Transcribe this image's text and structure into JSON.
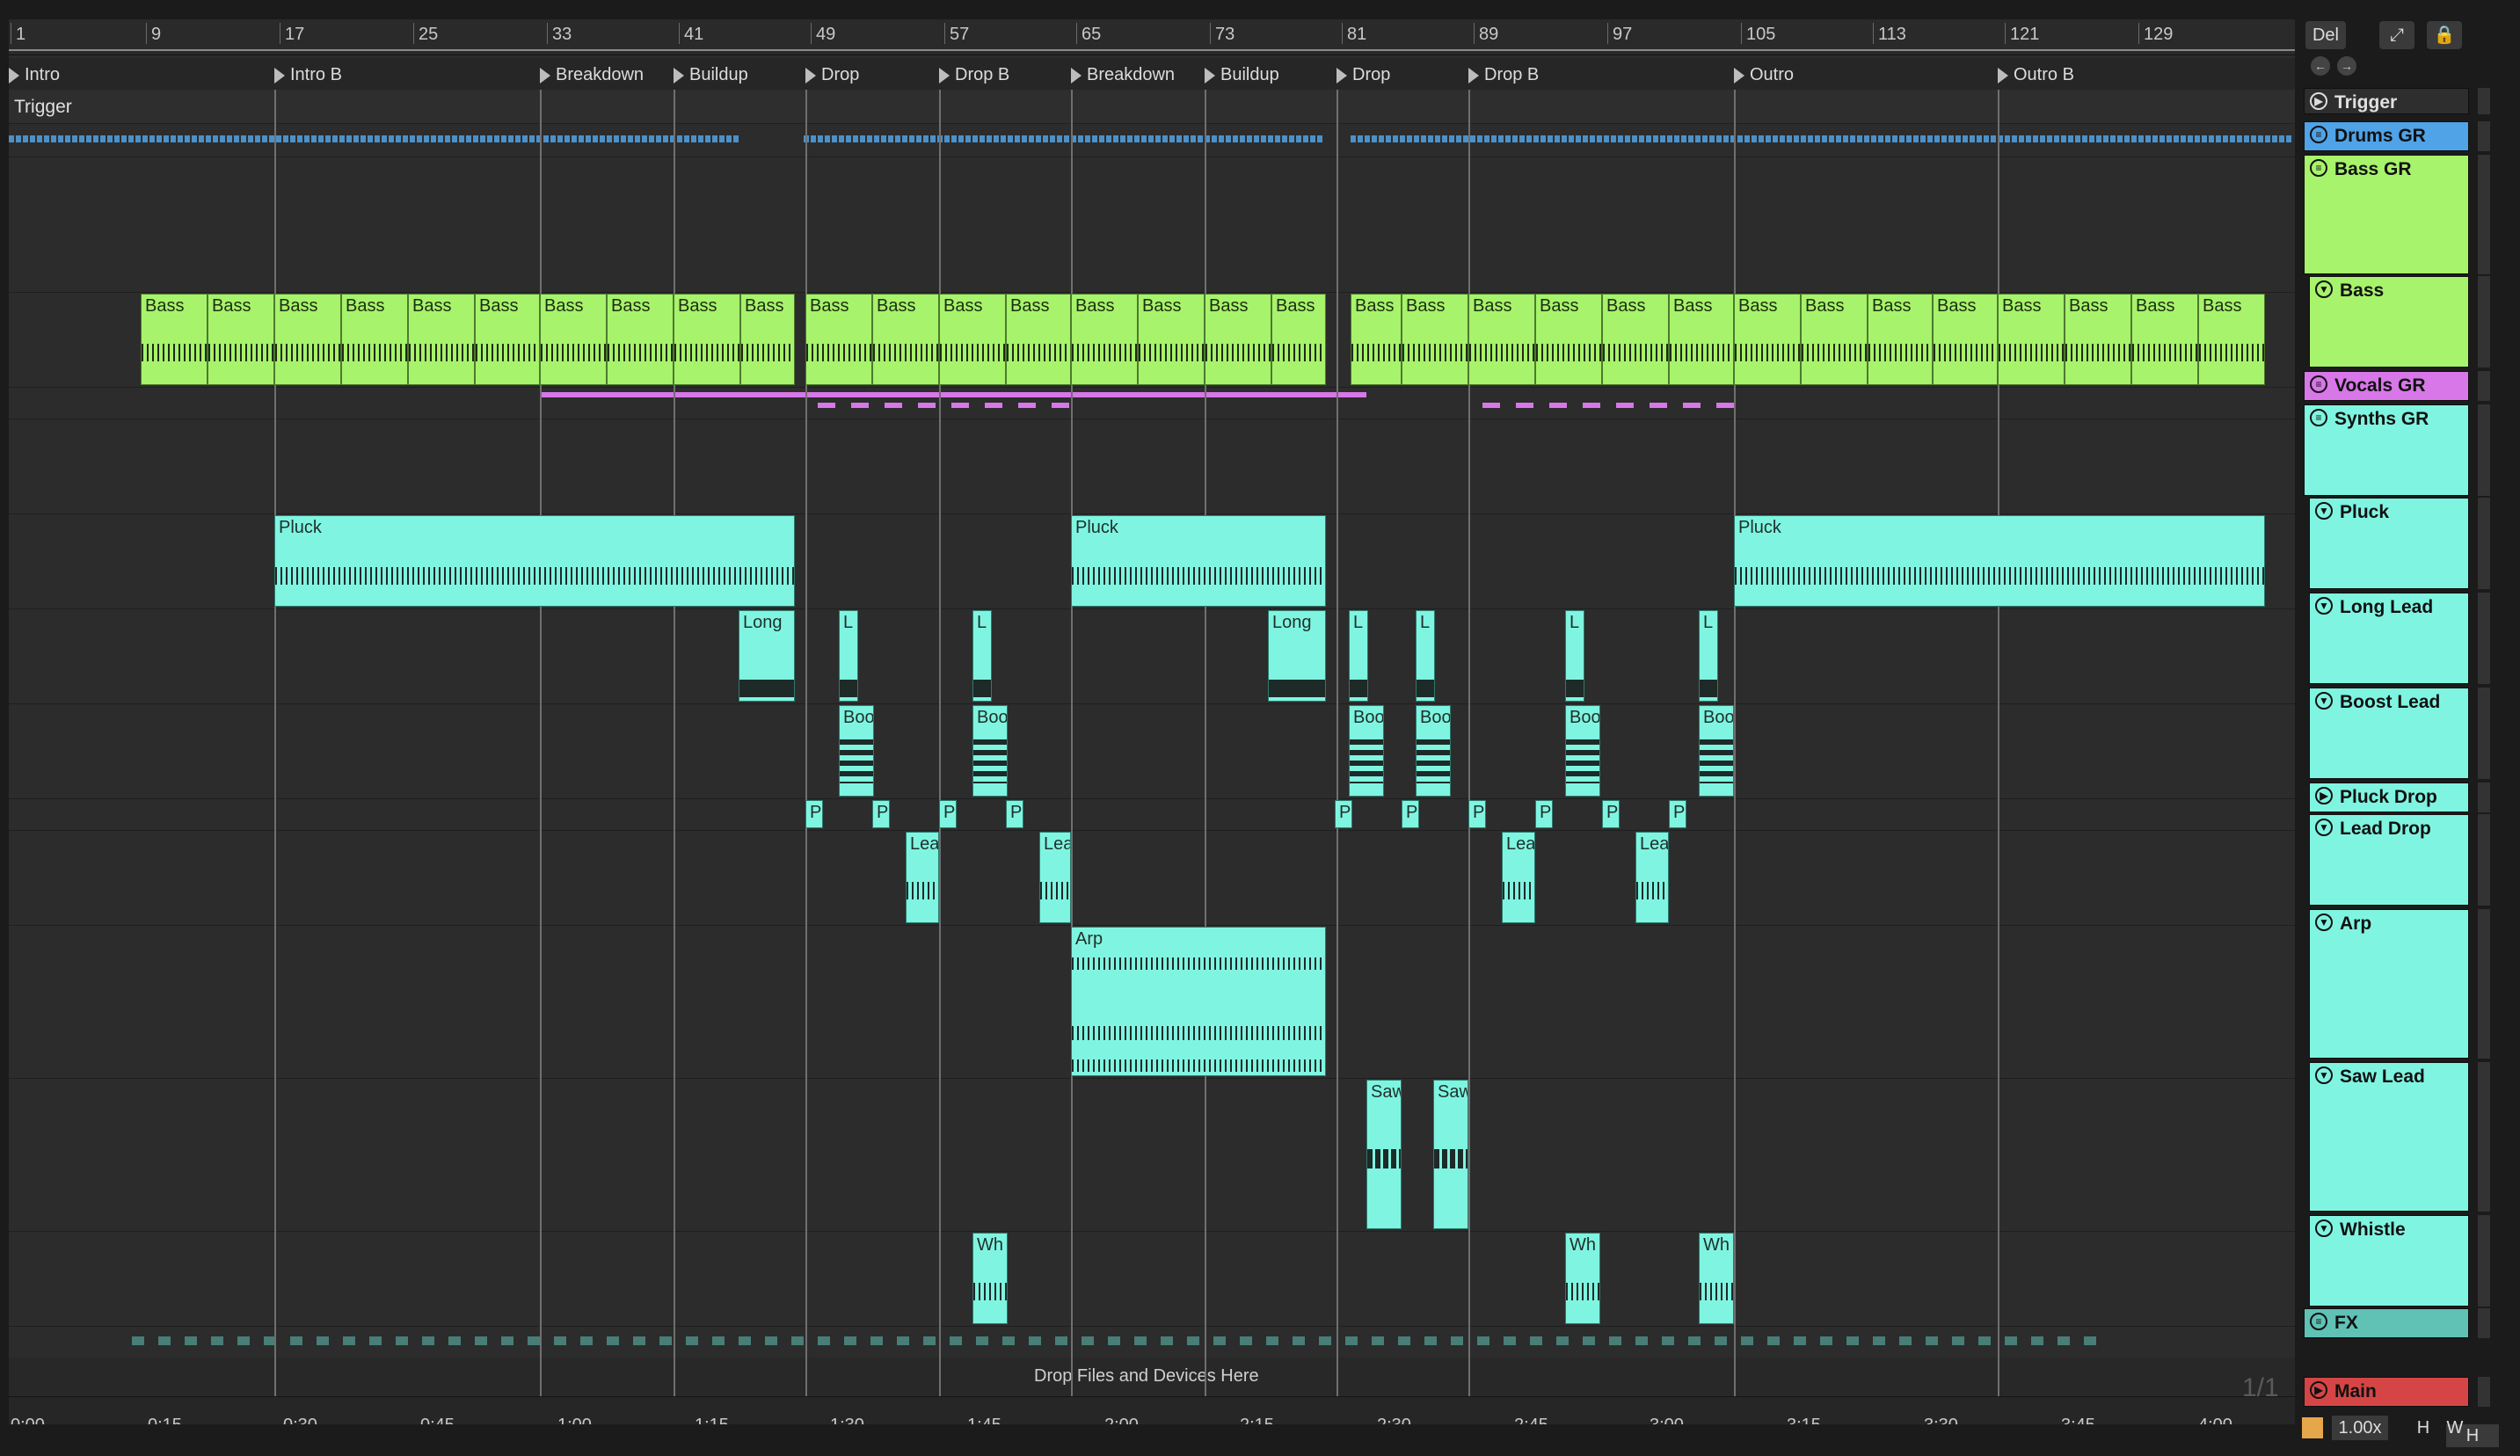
{
  "ruler": {
    "bars": [
      "1",
      "9",
      "17",
      "25",
      "33",
      "41",
      "49",
      "57",
      "65",
      "73",
      "81",
      "89",
      "97",
      "105",
      "113",
      "121",
      "129"
    ]
  },
  "locators": [
    "Intro",
    "Intro B",
    "Breakdown",
    "Buildup",
    "Drop",
    "Drop B",
    "Breakdown",
    "Buildup",
    "Drop",
    "Drop B",
    "Outro",
    "Outro B"
  ],
  "timeline": [
    "0:00",
    "0:15",
    "0:30",
    "0:45",
    "1:00",
    "1:15",
    "1:30",
    "1:45",
    "2:00",
    "2:15",
    "2:30",
    "2:45",
    "3:00",
    "3:15",
    "3:30",
    "3:45",
    "4:00"
  ],
  "trigger_label": "Trigger",
  "drop_files": "Drop Files and Devices Here",
  "page_indicator": "1/1",
  "controls": {
    "del": "Del",
    "zoom": "1.00x",
    "h": "H",
    "w": "W"
  },
  "clips": {
    "bass": "Bass",
    "pluck": "Pluck",
    "long": "Long",
    "long_short": "L",
    "boost_short": "Boo",
    "pluckdrop_short": "P",
    "lead_short": "Lea",
    "arp": "Arp",
    "saw_short": "Saw",
    "whistle_short": "Wh"
  },
  "tracks": [
    {
      "name": "Trigger",
      "color": "#2a2a2a"
    },
    {
      "name": "Drums GR",
      "color": "#4fa3e6"
    },
    {
      "name": "Bass GR",
      "color": "#a7f36b"
    },
    {
      "name": "Bass",
      "color": "#a7f36b"
    },
    {
      "name": "Vocals GR",
      "color": "#d777e8"
    },
    {
      "name": "Synths GR",
      "color": "#7ff5e1"
    },
    {
      "name": "Pluck",
      "color": "#7ff5e1"
    },
    {
      "name": "Long Lead",
      "color": "#7ff5e1"
    },
    {
      "name": "Boost Lead",
      "color": "#7ff5e1"
    },
    {
      "name": "Pluck Drop",
      "color": "#7ff5e1"
    },
    {
      "name": "Lead Drop",
      "color": "#7ff5e1"
    },
    {
      "name": "Arp",
      "color": "#7ff5e1"
    },
    {
      "name": "Saw Lead",
      "color": "#7ff5e1"
    },
    {
      "name": "Whistle",
      "color": "#7ff5e1"
    },
    {
      "name": "FX",
      "color": "#5fc2b5"
    },
    {
      "name": "Main",
      "color": "#d64545"
    }
  ]
}
